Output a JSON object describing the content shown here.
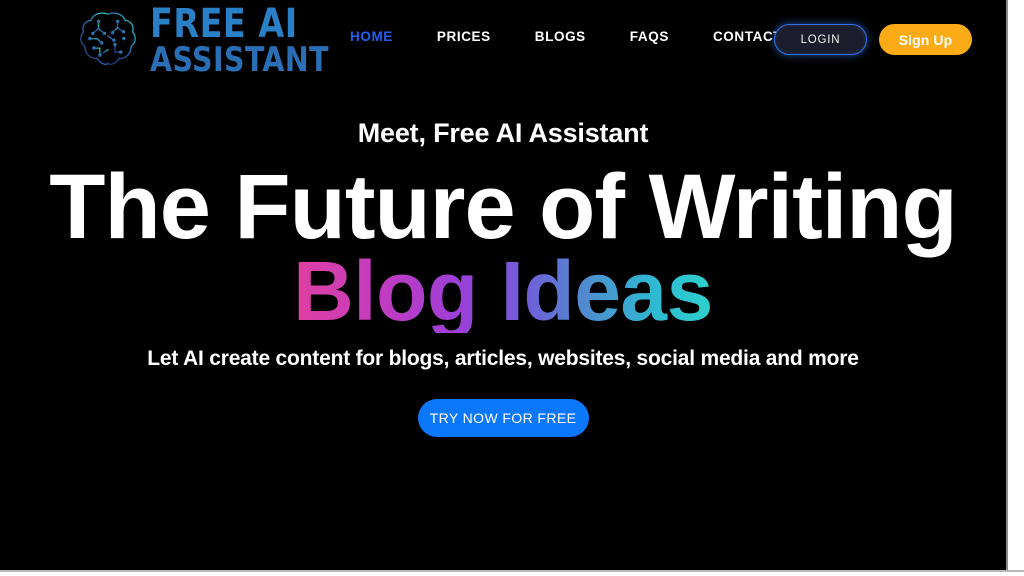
{
  "brand": {
    "logo_icon": "brain-circuit-icon",
    "name_line1": "FREE AI",
    "name_line2": "ASSISTANT",
    "logo_color": "#2a80c6"
  },
  "nav": {
    "items": [
      {
        "label": "HOME",
        "active": true
      },
      {
        "label": "PRICES",
        "active": false
      },
      {
        "label": "BLOGS",
        "active": false
      },
      {
        "label": "FAQS",
        "active": false
      },
      {
        "label": "CONTACT US",
        "active": false
      }
    ],
    "active_color": "#1f60f2",
    "inactive_color": "#ffffff"
  },
  "header_actions": {
    "login_label": "LOGIN",
    "signup_label": "Sign Up",
    "login_border_color": "#2f72e0",
    "signup_background": "#fbab16"
  },
  "hero": {
    "eyebrow": "Meet, Free AI Assistant",
    "headline": "The Future of Writing",
    "headline_gradient": "Blog Ideas",
    "gradient_start": "#e03fa2",
    "gradient_mid": "#9b3fd9",
    "gradient_end": "#2ed2cd",
    "subtitle": "Let AI create content for blogs, articles, websites, social media and more",
    "cta_label": "TRY NOW FOR FREE",
    "cta_color": "#0b78fb"
  },
  "page": {
    "background": "#000000"
  }
}
